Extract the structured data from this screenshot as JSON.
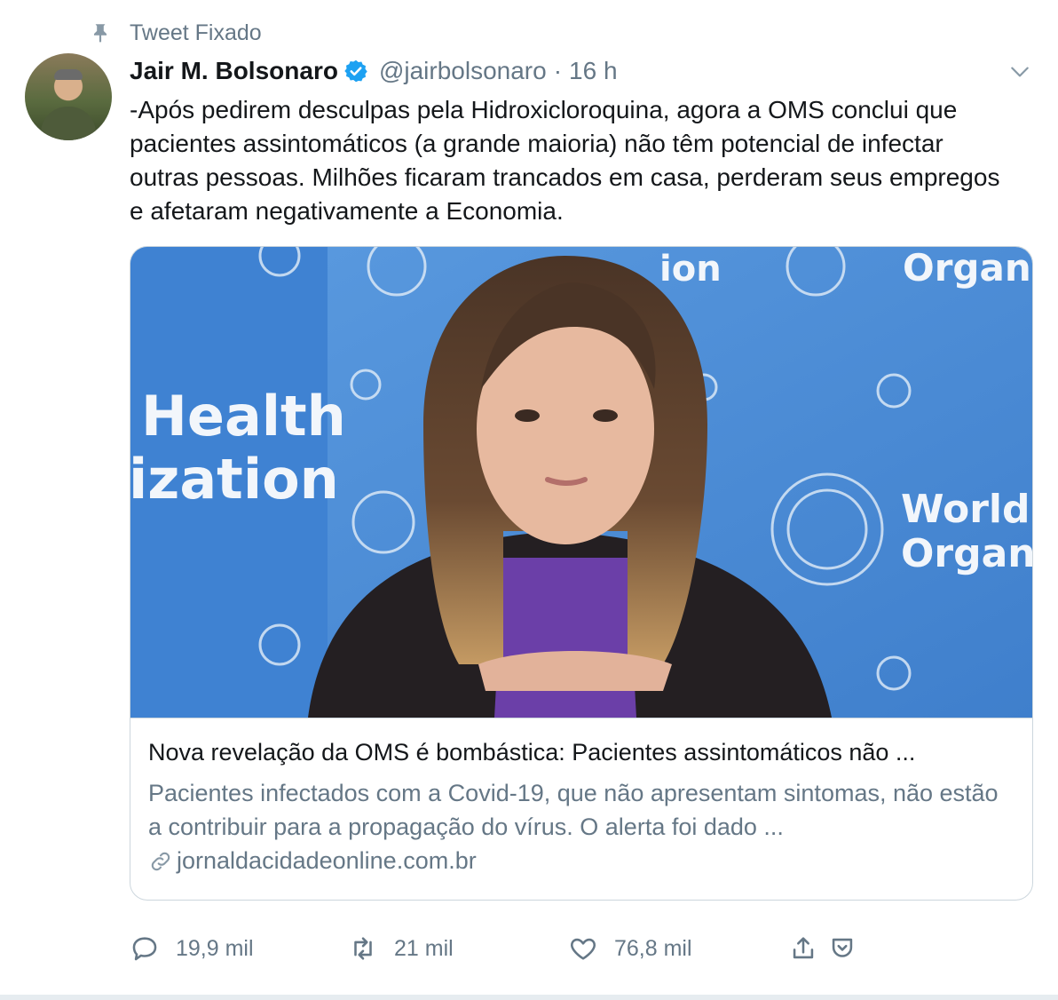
{
  "pinned": {
    "label": "Tweet Fixado",
    "icon": "pin-icon"
  },
  "author": {
    "name": "Jair M. Bolsonaro",
    "handle": "@jairbolsonaro",
    "separator": "·",
    "time": "16 h",
    "verified": true
  },
  "tweet": {
    "text": "-Após pedirem desculpas pela Hidroxicloroquina, agora a OMS conclui que pacientes assintomáticos (a grande maioria) não têm potencial de infectar outras pessoas. Milhões ficaram trancados em casa, perderam seus empregos e afetaram negativamente a Economia."
  },
  "card": {
    "title": "Nova revelação da OMS é bombástica: Pacientes assintomáticos não ...",
    "description": "Pacientes infectados com a Covid-19, que não apresentam sintomas, não estão a contribuir para a propagação do vírus. O alerta foi dado ...",
    "domain": "jornaldacidadeonline.com.br",
    "image_text": {
      "left_line1": "Health",
      "left_line2": "ization",
      "top_mid": "ion",
      "top_right": "Organiz",
      "right_line1": "World H",
      "right_line2": "Organiz"
    }
  },
  "actions": {
    "reply_count": "19,9 mil",
    "retweet_count": "21 mil",
    "like_count": "76,8 mil"
  },
  "colors": {
    "brand": "#1da1f2",
    "muted": "#657786",
    "border": "#ccd6dd",
    "backdrop": "#4f8fd6"
  }
}
